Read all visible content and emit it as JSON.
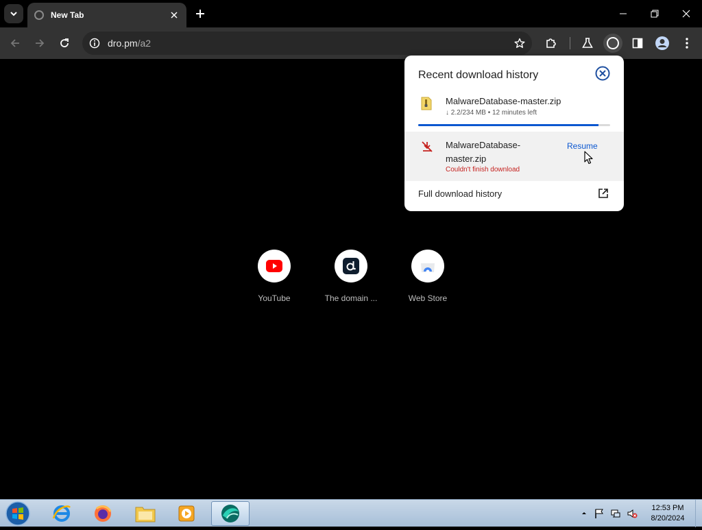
{
  "tab": {
    "title": "New Tab"
  },
  "omnibox": {
    "domain": "dro.pm",
    "path": "/a2"
  },
  "shortcuts": [
    {
      "label": "YouTube"
    },
    {
      "label": "The domain ..."
    },
    {
      "label": "Web Store"
    }
  ],
  "downloads": {
    "title": "Recent download history",
    "item1": {
      "name": "MalwareDatabase-master.zip",
      "status": "↓ 2.2/234 MB • 12 minutes left",
      "progress": 0.94
    },
    "item2": {
      "name": "MalwareDatabase-master.zip",
      "error": "Couldn't finish download",
      "action": "Resume"
    },
    "full_history": "Full download history"
  },
  "taskbar": {
    "time": "12:53 PM",
    "date": "8/20/2024"
  },
  "colors": {
    "accent": "#0b57d0",
    "error": "#c5221f",
    "toolbar": "#333333"
  }
}
